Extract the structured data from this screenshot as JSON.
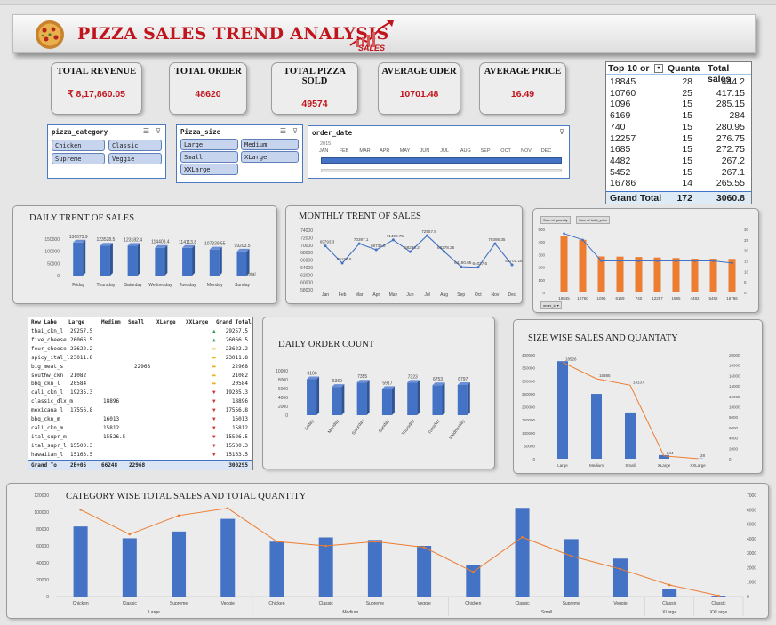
{
  "title": "PIZZA SALES TREND ANALYSIS",
  "logo_text": "SALES",
  "kpis": [
    {
      "label": "TOTAL REVENUE",
      "value": "₹ 8,17,860.05"
    },
    {
      "label": "TOTAL ORDER",
      "value": "48620"
    },
    {
      "label": "TOTAL PIZZA SOLD",
      "value": "49574"
    },
    {
      "label": "AVERAGE ODER",
      "value": "10701.48"
    },
    {
      "label": "AVERAGE PRICE",
      "value": "16.49"
    }
  ],
  "slicers": {
    "category": {
      "title": "pizza_category",
      "items": [
        "Chicken",
        "Classic",
        "Supreme",
        "Veggie"
      ]
    },
    "size": {
      "title": "Pizza_size",
      "items": [
        "Large",
        "Medium",
        "Small",
        "XLarge",
        "XXLarge"
      ]
    },
    "timeline": {
      "title": "order_date",
      "year": "2015",
      "months": [
        "JAN",
        "FEB",
        "MAR",
        "APR",
        "MAY",
        "JUN",
        "JUL",
        "AUG",
        "SEP",
        "OCT",
        "NOV",
        "DEC"
      ]
    }
  },
  "top10": {
    "headers": [
      "Top 10 or",
      "Quanta",
      "Total sales"
    ],
    "rows": [
      [
        "18845",
        "28",
        "444.2"
      ],
      [
        "10760",
        "25",
        "417.15"
      ],
      [
        "1096",
        "15",
        "285.15"
      ],
      [
        "6169",
        "15",
        "284"
      ],
      [
        "740",
        "15",
        "280.95"
      ],
      [
        "12257",
        "15",
        "276.75"
      ],
      [
        "1685",
        "15",
        "272.75"
      ],
      [
        "4482",
        "15",
        "267.2"
      ],
      [
        "5452",
        "15",
        "267.1"
      ],
      [
        "16786",
        "14",
        "265.55"
      ]
    ],
    "total": [
      "Grand Total",
      "172",
      "3060.8"
    ]
  },
  "matrix": {
    "headers": [
      "Row Labe",
      "Large",
      "Medium",
      "Small",
      "XLarge",
      "XXLarge",
      "Grand Total"
    ],
    "rows": [
      {
        "name": "thai_ckn_l",
        "large": "29257.5",
        "medium": "",
        "small": "",
        "xlarge": "",
        "total": "29257.5",
        "icon": "up"
      },
      {
        "name": "five_cheese",
        "large": "26066.5",
        "medium": "",
        "small": "",
        "xlarge": "",
        "total": "26066.5",
        "icon": "up"
      },
      {
        "name": "four_cheese",
        "large": "23622.2",
        "medium": "",
        "small": "",
        "xlarge": "",
        "total": "23622.2",
        "icon": "mid"
      },
      {
        "name": "spicy_ital_l",
        "large": "23011.8",
        "medium": "",
        "small": "",
        "xlarge": "",
        "total": "23011.8",
        "icon": "mid"
      },
      {
        "name": "big_meat_s",
        "large": "",
        "medium": "",
        "small": "22968",
        "xlarge": "",
        "total": "22968",
        "icon": "mid"
      },
      {
        "name": "southw_ckn",
        "large": "21082",
        "medium": "",
        "small": "",
        "xlarge": "",
        "total": "21082",
        "icon": "mid"
      },
      {
        "name": "bbq_ckn_l",
        "large": "20584",
        "medium": "",
        "small": "",
        "xlarge": "",
        "total": "20584",
        "icon": "mid"
      },
      {
        "name": "cali_ckn_l",
        "large": "19235.3",
        "medium": "",
        "small": "",
        "xlarge": "",
        "total": "19235.3",
        "icon": "down"
      },
      {
        "name": "classic_dlx_m",
        "large": "",
        "medium": "18896",
        "small": "",
        "xlarge": "",
        "total": "18896",
        "icon": "down"
      },
      {
        "name": "mexicana_l",
        "large": "17556.8",
        "medium": "",
        "small": "",
        "xlarge": "",
        "total": "17556.8",
        "icon": "down"
      },
      {
        "name": "bbq_ckn_m",
        "large": "",
        "medium": "16013",
        "small": "",
        "xlarge": "",
        "total": "16013",
        "icon": "down"
      },
      {
        "name": "cali_ckn_m",
        "large": "",
        "medium": "15812",
        "small": "",
        "xlarge": "",
        "total": "15812",
        "icon": "down"
      },
      {
        "name": "ital_supr_m",
        "large": "",
        "medium": "15526.5",
        "small": "",
        "xlarge": "",
        "total": "15526.5",
        "icon": "down"
      },
      {
        "name": "ital_supr_l",
        "large": "15500.3",
        "medium": "",
        "small": "",
        "xlarge": "",
        "total": "15500.3",
        "icon": "down"
      },
      {
        "name": "hawaiian_l",
        "large": "15163.5",
        "medium": "",
        "small": "",
        "xlarge": "",
        "total": "15163.5",
        "icon": "down"
      }
    ],
    "total": {
      "name": "Grand To",
      "large": "2E+05",
      "medium": "66248",
      "small": "22968",
      "xlarge": "",
      "total": "300295"
    }
  },
  "chart_data": [
    {
      "id": "daily_sales",
      "type": "bar",
      "title": "DAILY TRENT OF SALES",
      "categories": [
        "Friday",
        "Thursday",
        "Saturday",
        "Wednesday",
        "Tuesday",
        "Monday",
        "Sunday"
      ],
      "values": [
        136073.9,
        123528.5,
        123182.4,
        114408.4,
        114113.8,
        107329.55,
        99203.5
      ],
      "labels": [
        "136073.9",
        "123528.5",
        "123182.4",
        "114408.4",
        "114113.8",
        "107329.55",
        "99203.5"
      ],
      "yticks": [
        "150000",
        "100000",
        "50000",
        "0"
      ],
      "ylim": [
        0,
        150000
      ],
      "legend": "Total"
    },
    {
      "id": "monthly_sales",
      "type": "line",
      "title": "MONTHLY TRENT OF SALES",
      "categories": [
        "Jan",
        "Feb",
        "Mar",
        "Apr",
        "May",
        "Jun",
        "Jul",
        "Aug",
        "Sep",
        "Oct",
        "Nov",
        "Dec"
      ],
      "values": [
        69793.3,
        65159.6,
        70397.1,
        68736.8,
        71402.75,
        68230.2,
        72557.9,
        68278.25,
        64180.05,
        64027.6,
        70395.35,
        64701.15
      ],
      "labels": [
        "69793.3",
        "65159.6",
        "70397.1",
        "68736.8",
        "71402.75",
        "68230.2",
        "72557.9",
        "68278.25",
        "64180.05",
        "64027.6",
        "70395.35",
        "64701.15"
      ],
      "yticks": [
        "74000",
        "72000",
        "70000",
        "68000",
        "66000",
        "64000",
        "62000",
        "60000",
        "58000"
      ],
      "ylim": [
        58000,
        74000
      ]
    },
    {
      "id": "top10_chart",
      "type": "bar",
      "legend_buttons": [
        "Sum of quantity",
        "Sum of total_price"
      ],
      "axis_button": "order_id",
      "categories": [
        "18845",
        "10760",
        "1096",
        "6169",
        "740",
        "12257",
        "1685",
        "4482",
        "5452",
        "16786"
      ],
      "series": [
        {
          "values": [
            444.2,
            417.15,
            285.15,
            284,
            280.95,
            276.75,
            272.75,
            267.2,
            267.1,
            265.55
          ]
        },
        {
          "values": [
            28,
            25,
            15,
            15,
            15,
            15,
            15,
            15,
            15,
            14
          ]
        }
      ],
      "yticks_left": [
        "500",
        "400",
        "300",
        "200",
        "100",
        "0"
      ],
      "ylim_left": [
        0,
        500
      ],
      "yticks_right": [
        "30",
        "25",
        "20",
        "15",
        "10",
        "5",
        "0"
      ],
      "ylim_right": [
        0,
        30
      ]
    },
    {
      "id": "daily_orders",
      "type": "bar",
      "title": "DAILY ORDER COUNT",
      "categories": [
        "Friday",
        "Monday",
        "Saturday",
        "Sunday",
        "Thursday",
        "Tuesday",
        "Wednesday"
      ],
      "values": [
        8106,
        6369,
        7355,
        5917,
        7323,
        6753,
        6797
      ],
      "labels": [
        "8106",
        "6369",
        "7355",
        "5917",
        "7323",
        "6753",
        "6797"
      ],
      "yticks": [
        "10000",
        "8000",
        "6000",
        "4000",
        "2000",
        "0"
      ],
      "ylim": [
        0,
        10000
      ]
    },
    {
      "id": "size_sales",
      "type": "bar",
      "title": "SIZE WISE SALES AND QUANTATY",
      "categories": [
        "Large",
        "Medium",
        "Small",
        "XLarge",
        "XXLarge"
      ],
      "series": [
        {
          "values": [
            375318.7,
            249382.25,
            178076.5,
            14076,
            1006.6
          ]
        },
        {
          "values": [
            18526,
            15385,
            14137,
            544,
            28
          ]
        }
      ],
      "labels": [
        "18526",
        "15385",
        "14137",
        "544",
        "28"
      ],
      "yticks_left": [
        "400000",
        "350000",
        "300000",
        "250000",
        "200000",
        "150000",
        "100000",
        "50000",
        "0"
      ],
      "ylim_left": [
        0,
        400000
      ],
      "yticks_right": [
        "20000",
        "18000",
        "16000",
        "14000",
        "12000",
        "10000",
        "8000",
        "6000",
        "4000",
        "2000",
        "0"
      ],
      "ylim_right": [
        0,
        20000
      ]
    },
    {
      "id": "category_sales",
      "type": "bar",
      "title": "CATEGORY WISE TOTAL SALES AND TOTAL QUANTITY",
      "categories": [
        "Chicken",
        "Classic",
        "Supreme",
        "Veggie",
        "Chicken",
        "Classic",
        "Supreme",
        "Veggie",
        "Chicken",
        "Classic",
        "Supreme",
        "Veggie",
        "Classic",
        "Classic"
      ],
      "groups": [
        {
          "name": "Large",
          "count": 4
        },
        {
          "name": "Medium",
          "count": 4
        },
        {
          "name": "Small",
          "count": 4
        },
        {
          "name": "XLarge",
          "count": 1
        },
        {
          "name": "XXLarge",
          "count": 1
        }
      ],
      "series": [
        {
          "values": [
            83000,
            69000,
            77000,
            92000,
            65000,
            70000,
            67000,
            60000,
            37000,
            105000,
            68000,
            45000,
            9000,
            1000
          ]
        },
        {
          "values": [
            6000,
            4300,
            5600,
            6100,
            3800,
            3500,
            3800,
            3400,
            1700,
            4100,
            2800,
            1900,
            800,
            60
          ]
        }
      ],
      "yticks_left": [
        "120000",
        "100000",
        "80000",
        "60000",
        "40000",
        "20000",
        "0"
      ],
      "ylim_left": [
        0,
        120000
      ],
      "yticks_right": [
        "7000",
        "6000",
        "5000",
        "4000",
        "3000",
        "2000",
        "1000",
        "0"
      ],
      "ylim_right": [
        0,
        7000
      ]
    }
  ]
}
